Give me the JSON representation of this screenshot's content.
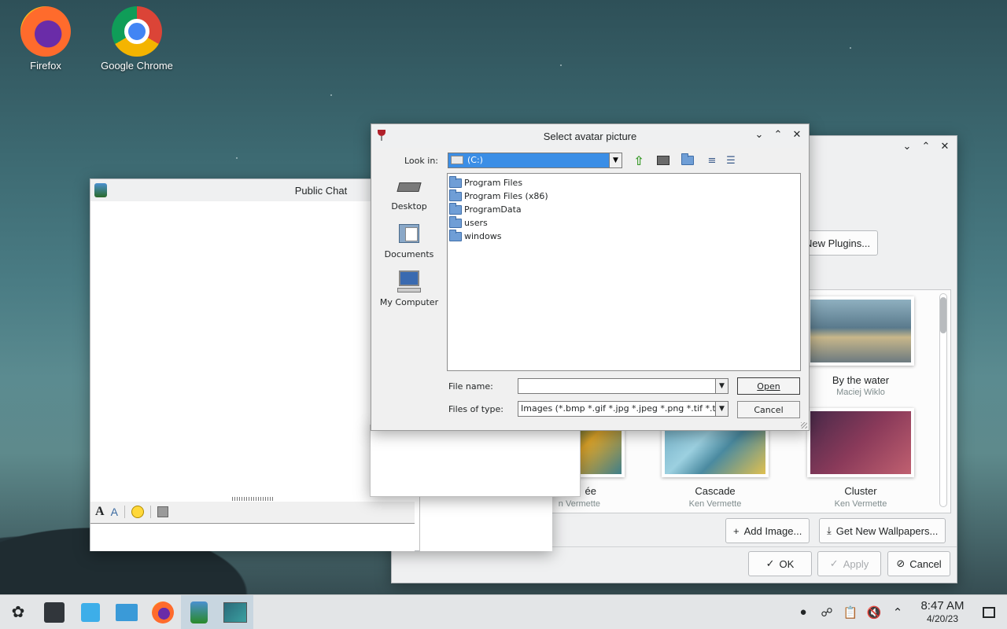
{
  "desktop": {
    "icons": [
      {
        "label": "Firefox",
        "icon": "firefox-icon"
      },
      {
        "label": "Google Chrome",
        "icon": "chrome-icon"
      }
    ]
  },
  "wallpaper_window": {
    "new_plugins_label": "New Plugins...",
    "wallpapers": [
      {
        "title": "By the water",
        "author": "Maciej Wiklo"
      },
      {
        "title": "ée",
        "author": "n Vermette"
      },
      {
        "title": "Cascade",
        "author": "Ken Vermette"
      },
      {
        "title": "Cluster",
        "author": "Ken Vermette"
      }
    ],
    "add_image_label": "Add Image...",
    "get_new_label": "Get New Wallpapers...",
    "ok_label": "OK",
    "apply_label": "Apply",
    "cancel_label": "Cancel"
  },
  "chat_window": {
    "title": "Public Chat"
  },
  "dialog": {
    "title": "Select avatar picture",
    "look_in_label": "Look in:",
    "look_in_value": "(C:)",
    "places": [
      {
        "label": "Desktop",
        "icon": "desktop-icon"
      },
      {
        "label": "Documents",
        "icon": "documents-icon"
      },
      {
        "label": "My Computer",
        "icon": "my-computer-icon"
      }
    ],
    "files": [
      "Program Files",
      "Program Files (x86)",
      "ProgramData",
      "users",
      "windows"
    ],
    "file_name_label": "File name:",
    "file_name_value": "",
    "files_of_type_label": "Files of type:",
    "files_of_type_value": "Images (*.bmp *.gif *.jpg *.jpeg *.png *.tif *.tiff)",
    "open_label": "Open",
    "cancel_label": "Cancel"
  },
  "taskbar": {
    "time": "8:47 AM",
    "date": "4/20/23"
  },
  "colors": {
    "accent": "#3b8ee6",
    "taskbar": "#e3e5e7"
  }
}
